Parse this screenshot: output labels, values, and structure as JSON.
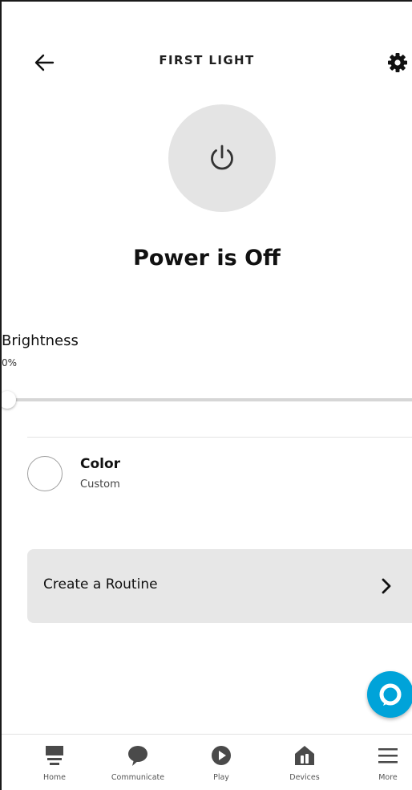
{
  "header": {
    "title": "FIRST LIGHT",
    "back_icon": "arrow-left-icon",
    "settings_icon": "gear-icon"
  },
  "power": {
    "icon": "power-icon",
    "status": "Power is Off"
  },
  "brightness": {
    "label": "Brightness",
    "value_text": "0%",
    "level": 0
  },
  "color": {
    "title": "Color",
    "subtitle": "Custom"
  },
  "routine": {
    "label": "Create a Routine",
    "chevron_icon": "chevron-right-icon"
  },
  "alexa_button": {
    "icon": "alexa-ring-icon"
  },
  "nav": {
    "items": [
      {
        "label": "Home",
        "icon": "home-icon"
      },
      {
        "label": "Communicate",
        "icon": "chat-bubble-icon"
      },
      {
        "label": "Play",
        "icon": "play-icon"
      },
      {
        "label": "Devices",
        "icon": "devices-house-icon"
      },
      {
        "label": "More",
        "icon": "menu-icon"
      }
    ]
  },
  "colors": {
    "alexa_blue": "#00a3d9",
    "power_circle": "#e4e4e4",
    "card_bg": "#e7e7e7",
    "nav_icon": "#4a4a4a"
  }
}
